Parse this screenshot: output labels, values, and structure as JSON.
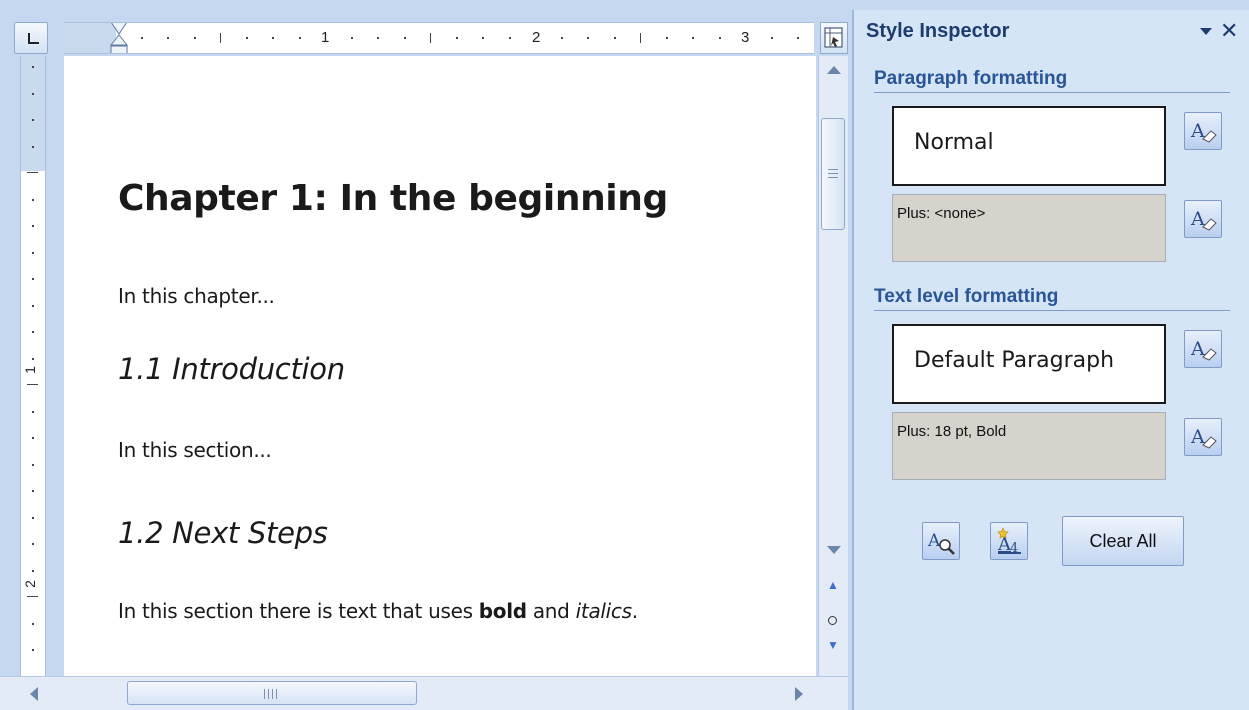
{
  "document": {
    "heading1": "Chapter 1: In the beginning",
    "para1": "In this chapter...",
    "heading2a": "1.1 Introduction",
    "para2": "In this section...",
    "heading2b": "1.2 Next Steps",
    "para3_before": "In this section there is text that uses ",
    "para3_bold": "bold",
    "para3_mid": " and ",
    "para3_italic": "italics",
    "para3_after": "."
  },
  "ruler": {
    "h_numbers": [
      "1",
      "2",
      "3"
    ],
    "v_numbers": [
      "1",
      "2"
    ]
  },
  "panel": {
    "title": "Style Inspector",
    "menu_icon": "dropdown-arrow-icon",
    "close_icon": "close-icon",
    "paragraph_section": {
      "title": "Paragraph formatting",
      "style_name": "Normal",
      "plus": "Plus: <none>"
    },
    "text_section": {
      "title": "Text level formatting",
      "style_name": "Default Paragraph",
      "plus": "Plus: 18 pt, Bold"
    },
    "buttons": {
      "clear_all": "Clear All"
    }
  },
  "colors": {
    "panel_bg": "#d6e5f6",
    "section_title": "#2a5597",
    "frame_bg": "#c5d8ef"
  }
}
